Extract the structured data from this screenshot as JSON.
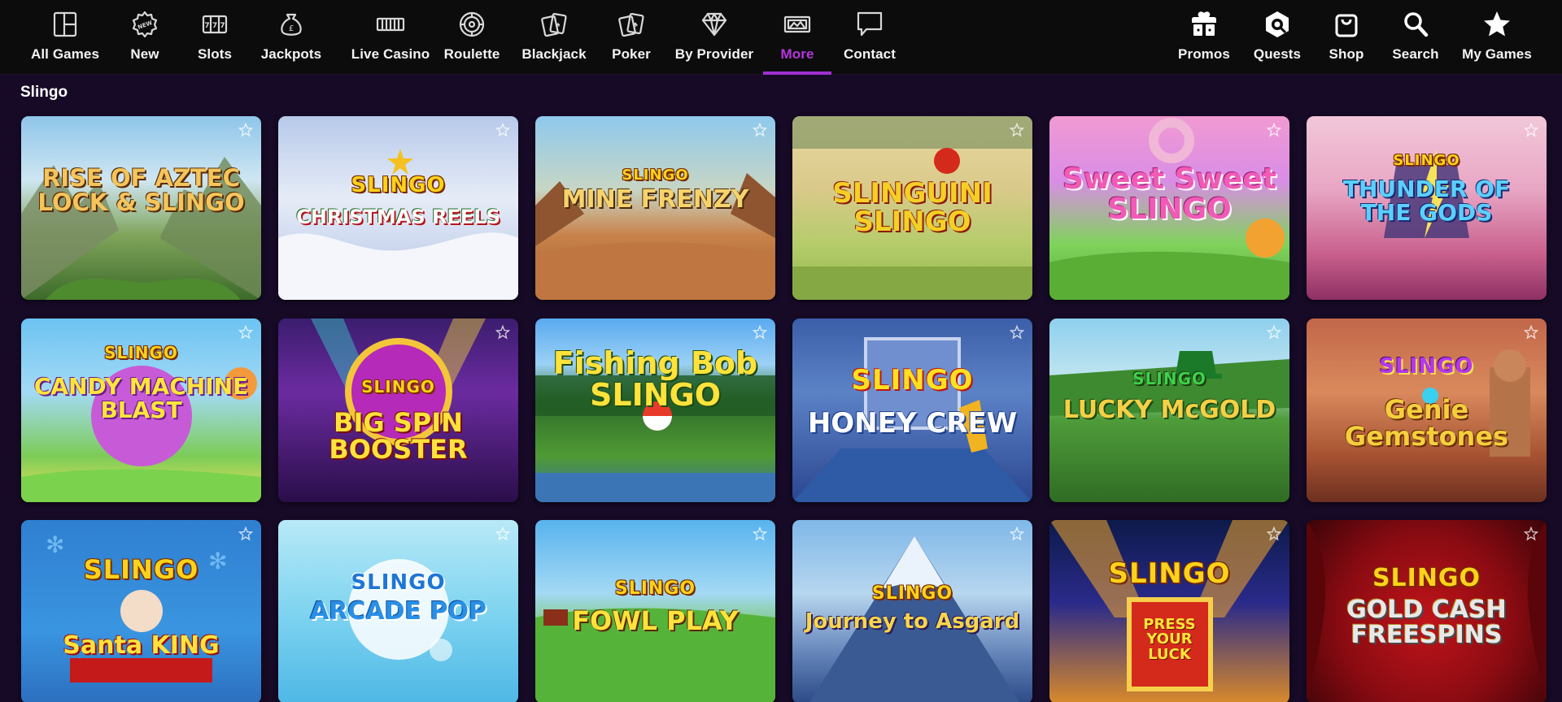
{
  "nav": {
    "left_items": [
      {
        "label": "All Games",
        "icon": "grid-icon"
      },
      {
        "label": "New",
        "icon": "new-badge-icon"
      },
      {
        "label": "Slots",
        "icon": "slot-reels-icon"
      },
      {
        "label": "Jackpots",
        "icon": "money-bag-icon"
      },
      {
        "label": "Live Casino",
        "icon": "live-casino-icon"
      },
      {
        "label": "Roulette",
        "icon": "roulette-icon"
      },
      {
        "label": "Blackjack",
        "icon": "blackjack-cards-icon"
      },
      {
        "label": "Poker",
        "icon": "poker-cards-icon"
      },
      {
        "label": "By Provider",
        "icon": "diamond-icon"
      },
      {
        "label": "More",
        "icon": "ticket-icon",
        "active": true
      },
      {
        "label": "Contact",
        "icon": "chat-bubble-icon"
      }
    ],
    "right_items": [
      {
        "label": "Promos",
        "icon": "gift-icon"
      },
      {
        "label": "Quests",
        "icon": "quests-icon"
      },
      {
        "label": "Shop",
        "icon": "shopping-bag-icon"
      },
      {
        "label": "Search",
        "icon": "search-icon"
      },
      {
        "label": "My Games",
        "icon": "star-icon"
      }
    ],
    "active_color": "#b537e0"
  },
  "section": {
    "title": "Slingo"
  },
  "games": [
    {
      "brand": "",
      "title": "RISE OF AZTEC LOCK & SLINGO",
      "icon": "aztec-temple-icon"
    },
    {
      "brand": "SLINGO",
      "title": "CHRISTMAS REELS",
      "icon": "christmas-tree-icon"
    },
    {
      "brand": "SLINGO",
      "title": "MINE FRENZY",
      "icon": "mine-cart-icon"
    },
    {
      "brand": "",
      "title": "SLINGUINI SLINGO",
      "icon": "tomato-icon"
    },
    {
      "brand": "",
      "title": "Sweet Sweet SLINGO",
      "icon": "donut-icon"
    },
    {
      "brand": "SLINGO",
      "title": "THUNDER OF THE GODS",
      "icon": "lightning-icon"
    },
    {
      "brand": "SLINGO",
      "title": "CANDY MACHINE BLAST",
      "icon": "lollipop-icon"
    },
    {
      "brand": "SLINGO",
      "title": "BIG SPIN BOOSTER",
      "icon": "wheel-icon"
    },
    {
      "brand": "",
      "title": "Fishing Bob SLINGO",
      "icon": "fishing-bobber-icon"
    },
    {
      "brand": "SLINGO",
      "title": "HONEY CREW",
      "icon": "honey-dipper-icon"
    },
    {
      "brand": "SLINGO",
      "title": "LUCKY McGOLD",
      "icon": "leprechaun-hat-icon"
    },
    {
      "brand": "SLINGO",
      "title": "Genie Gemstones",
      "icon": "genie-lamp-icon"
    },
    {
      "brand": "SLINGO",
      "title": "Santa KING",
      "icon": "santa-icon"
    },
    {
      "brand": "SLINGO",
      "title": "ARCADE POP",
      "icon": "bubble-icon"
    },
    {
      "brand": "SLINGO",
      "title": "FOWL PLAY",
      "icon": "tractor-icon"
    },
    {
      "brand": "SLINGO",
      "title": "Journey to Asgard",
      "icon": "mountain-icon"
    },
    {
      "brand": "SLINGO",
      "title": "PRESS YOUR LUCK",
      "icon": "game-board-icon"
    },
    {
      "brand": "SLINGO",
      "title": "GOLD CASH FREESPINS",
      "icon": "gold-coin-icon"
    }
  ]
}
